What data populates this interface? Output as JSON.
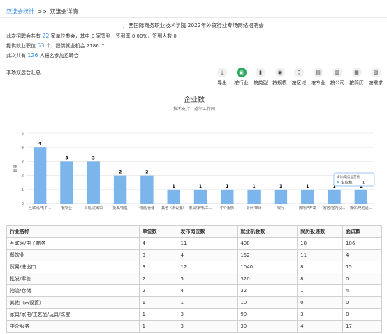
{
  "breadcrumb": {
    "parent": "双选会统计",
    "separator": ">>",
    "current": "双选会详情"
  },
  "title": "广西国际商务职业技术学院 2022年外贸行业专场网络招聘会",
  "info": {
    "line1_pre": "此次招聘会共有",
    "companies": "22",
    "line1_mid": "家单位参会，其中",
    "signed": "0",
    "line1_mid2": "家签到，签到率",
    "rate": "0.00%",
    "line1_mid3": "，签到人数",
    "signed_people": "0",
    "line2_pre": "提供就业职位",
    "positions": "53",
    "line2_mid": "个，提供就业机会",
    "jobs": "2186",
    "line2_post": "个",
    "line3_pre": "此次共有",
    "people": "126",
    "line3_post": "人报名参加招聘会"
  },
  "summary_label": "本场双选会汇总",
  "toolbar": [
    {
      "label": "导出",
      "icon": "download-icon",
      "glyph": "⤓",
      "active": false
    },
    {
      "label": "按行业",
      "icon": "briefcase-icon",
      "glyph": "▣",
      "active": true
    },
    {
      "label": "按类型",
      "icon": "bookmark-icon",
      "glyph": "▮",
      "active": false
    },
    {
      "label": "按规模",
      "icon": "globe-icon",
      "glyph": "◉",
      "active": false
    },
    {
      "label": "按区域",
      "icon": "location-pin-icon",
      "glyph": "⚲",
      "active": false
    },
    {
      "label": "按专业",
      "icon": "book-icon",
      "glyph": "▤",
      "active": false
    },
    {
      "label": "按公司",
      "icon": "building-icon",
      "glyph": "▥",
      "active": false
    },
    {
      "label": "按简历",
      "icon": "resume-icon",
      "glyph": "▦",
      "active": false
    },
    {
      "label": "按需求",
      "icon": "bars-icon",
      "glyph": "▧",
      "active": false
    }
  ],
  "chart_data": {
    "type": "bar",
    "title": "企业数",
    "subtitle": "技术支持：道尔工作网",
    "ylabel": "数量",
    "ylim": [
      0,
      5
    ],
    "yticks": [
      0,
      1,
      2,
      3,
      4,
      5
    ],
    "categories": [
      "互联网/电子…",
      "餐饮业",
      "贸易/进出口",
      "批发/零售",
      "物流/仓储",
      "其他（未设置）",
      "家具/家电/工…",
      "中介服务",
      "会计/审计",
      "银行",
      "房地产开发",
      "家居/室内设…",
      "媒体/电信运…"
    ],
    "values": [
      4,
      3,
      3,
      2,
      2,
      1,
      1,
      1,
      1,
      1,
      1,
      1,
      1
    ],
    "color": "#7cb5ec",
    "tooltip": {
      "title": "媒体/电信运营商",
      "series": "企业数",
      "value": "1"
    }
  },
  "table": {
    "headers": [
      "行业名称",
      "单位数",
      "发布岗位数",
      "就业机会数",
      "简历投递数",
      "面试数"
    ],
    "rows": [
      [
        "互联网/电子商务",
        "4",
        "11",
        "408",
        "18",
        "106"
      ],
      [
        "餐饮业",
        "3",
        "4",
        "152",
        "11",
        "4"
      ],
      [
        "贸易/进出口",
        "3",
        "12",
        "1040",
        "8",
        "15"
      ],
      [
        "批发/零售",
        "2",
        "5",
        "320",
        "8",
        "0"
      ],
      [
        "物流/仓储",
        "2",
        "4",
        "32",
        "1",
        "4"
      ],
      [
        "其他（未设置）",
        "1",
        "1",
        "10",
        "0",
        "0"
      ],
      [
        "家具/家电/工艺品/玩具/珠宝",
        "1",
        "3",
        "90",
        "3",
        "0"
      ],
      [
        "中介服务",
        "1",
        "3",
        "30",
        "4",
        "17"
      ]
    ]
  }
}
